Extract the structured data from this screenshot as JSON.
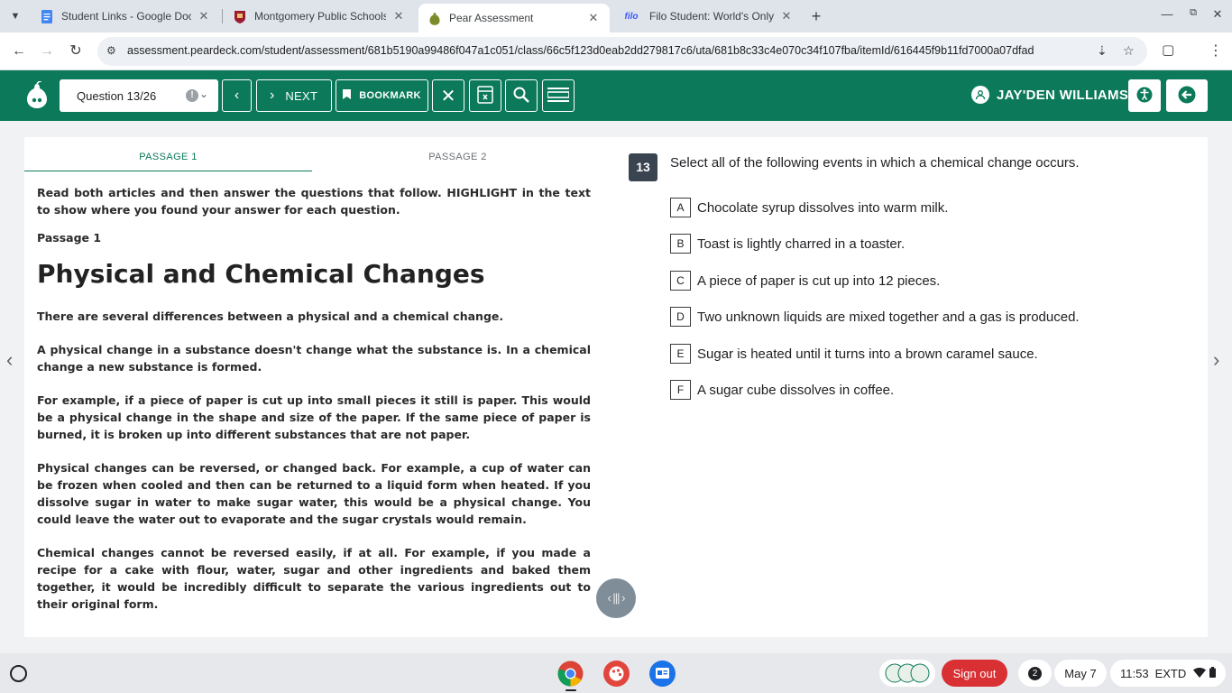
{
  "browser": {
    "tabs": [
      {
        "title": "Student Links - Google Docs",
        "favicon": "docs-icon"
      },
      {
        "title": "Montgomery Public Schools | H",
        "favicon": "school-icon"
      },
      {
        "title": "Pear Assessment",
        "favicon": "pear-icon",
        "active": true
      },
      {
        "title": "Filo Student: World's Only Live I",
        "favicon": "filo-icon"
      }
    ],
    "url": "assessment.peardeck.com/student/assessment/681b5190a99486f047a1c051/class/66c5f123d0eab2dd279817c6/uta/681b8c33c4e070c34f107fba/itemId/616445f9b11fd7000a07dfad",
    "filo_favicon_text": "filo"
  },
  "header": {
    "question_selector": "Question 13/26",
    "next_label": "NEXT",
    "bookmark_label": "BOOKMARK",
    "user_name": "JAY'DEN WILLIAMS"
  },
  "passage_tabs": [
    "PASSAGE 1",
    "PASSAGE 2"
  ],
  "passage": {
    "intro": "Read both articles and then answer the questions that follow.  HIGHLIGHT in the text to show where you found your answer for each question.",
    "label": "Passage 1",
    "title": "Physical and Chemical Changes",
    "paragraphs": [
      "There are several differences between a physical and a chemical change.",
      "A physical change in a substance doesn't change what the substance is. In a chemical change a new substance is formed.",
      "For example, if a piece of paper is cut up into small pieces it still is paper. This would be a physical change in the shape and size of the paper. If the same piece of paper is burned, it is broken up into different substances that are not paper.",
      "Physical changes can be reversed, or changed back.  For example, a cup of water can be frozen when cooled and then can be returned to a liquid form when heated.  If you dissolve sugar in water to make sugar water, this would be a physical change.  You could leave the water out to evaporate and the sugar crystals would remain.",
      "Chemical changes cannot be reversed easily, if at all.  For example, if you made a recipe for a cake with flour, water, sugar and other ingredients and baked them together, it would be incredibly difficult to separate the various ingredients out to their original form."
    ]
  },
  "question": {
    "number": "13",
    "text": "Select all of the following events in which a chemical change occurs.",
    "options": [
      {
        "letter": "A",
        "text": "Chocolate syrup dissolves into warm milk."
      },
      {
        "letter": "B",
        "text": "Toast is lightly charred in a toaster."
      },
      {
        "letter": "C",
        "text": "A piece of paper is cut up into 12 pieces."
      },
      {
        "letter": "D",
        "text": "Two unknown liquids are mixed together and a gas is produced."
      },
      {
        "letter": "E",
        "text": "Sugar is heated until it turns into a brown caramel sauce."
      },
      {
        "letter": "F",
        "text": "A sugar cube dissolves in coffee."
      }
    ]
  },
  "shelf": {
    "signout_label": "Sign out",
    "notification_count": "2",
    "date": "May 7",
    "time": "11:53",
    "timezone": "EXTD"
  },
  "colors": {
    "brand_green": "#0c7a5a",
    "signout_red": "#d93034",
    "question_badge": "#3a4350"
  }
}
